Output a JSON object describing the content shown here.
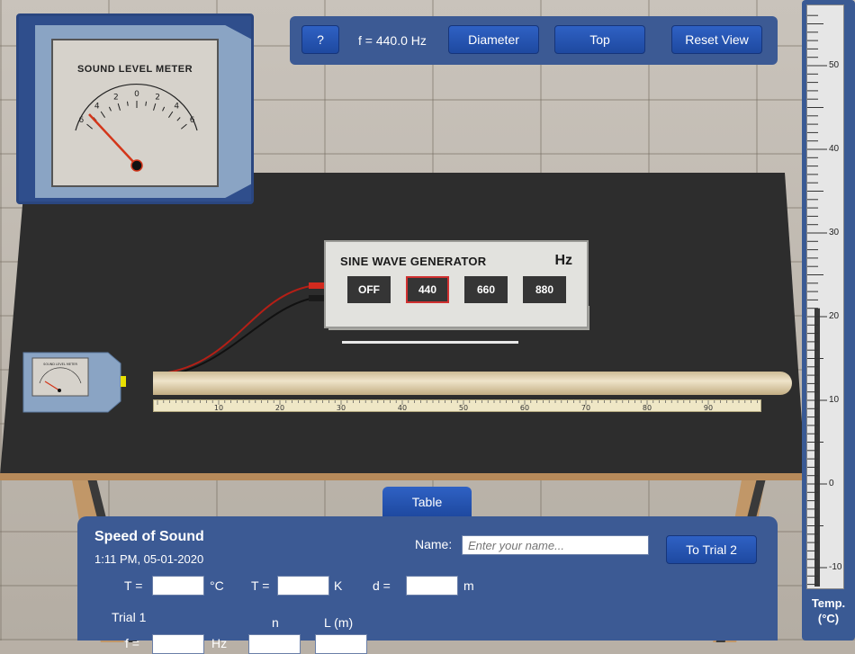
{
  "toolbar": {
    "help_label": "?",
    "frequency_label": "f = 440.0 Hz",
    "diameter_label": "Diameter",
    "top_label": "Top",
    "reset_label": "Reset View"
  },
  "sound_meter": {
    "title": "SOUND LEVEL METER",
    "scale_labels": [
      "6",
      "4",
      "2",
      "0",
      "2",
      "4",
      "6"
    ],
    "small_title": "SOUND LEVEL METER"
  },
  "generator": {
    "title": "SINE WAVE GENERATOR",
    "unit": "Hz",
    "buttons": [
      "OFF",
      "440",
      "660",
      "880"
    ],
    "selected": "440"
  },
  "ruler": {
    "labels": [
      "10",
      "20",
      "30",
      "40",
      "50",
      "60",
      "70",
      "80",
      "90"
    ]
  },
  "thermometer": {
    "labels": [
      "50",
      "40",
      "30",
      "20",
      "10",
      "0",
      "-10"
    ],
    "label_line1": "Temp.",
    "label_line2": "(°C)",
    "level_celsius": 21
  },
  "table_tab": "Table",
  "panel": {
    "title": "Speed of Sound",
    "timestamp": "1:11 PM, 05-01-2020",
    "name_label": "Name:",
    "name_placeholder": "Enter your name...",
    "trial_button": "To Trial 2",
    "t_c_label": "T =",
    "t_c_unit": "°C",
    "t_k_label": "T =",
    "t_k_unit": "K",
    "d_label": "d =",
    "d_unit": "m",
    "trial_label": "Trial 1",
    "n_header": "n",
    "l_header": "L (m)",
    "f_label": "f =",
    "f_unit": "Hz"
  },
  "colors": {
    "accent": "#1e49a0",
    "panel": "#3c5a94",
    "selected_border": "#d03030"
  }
}
